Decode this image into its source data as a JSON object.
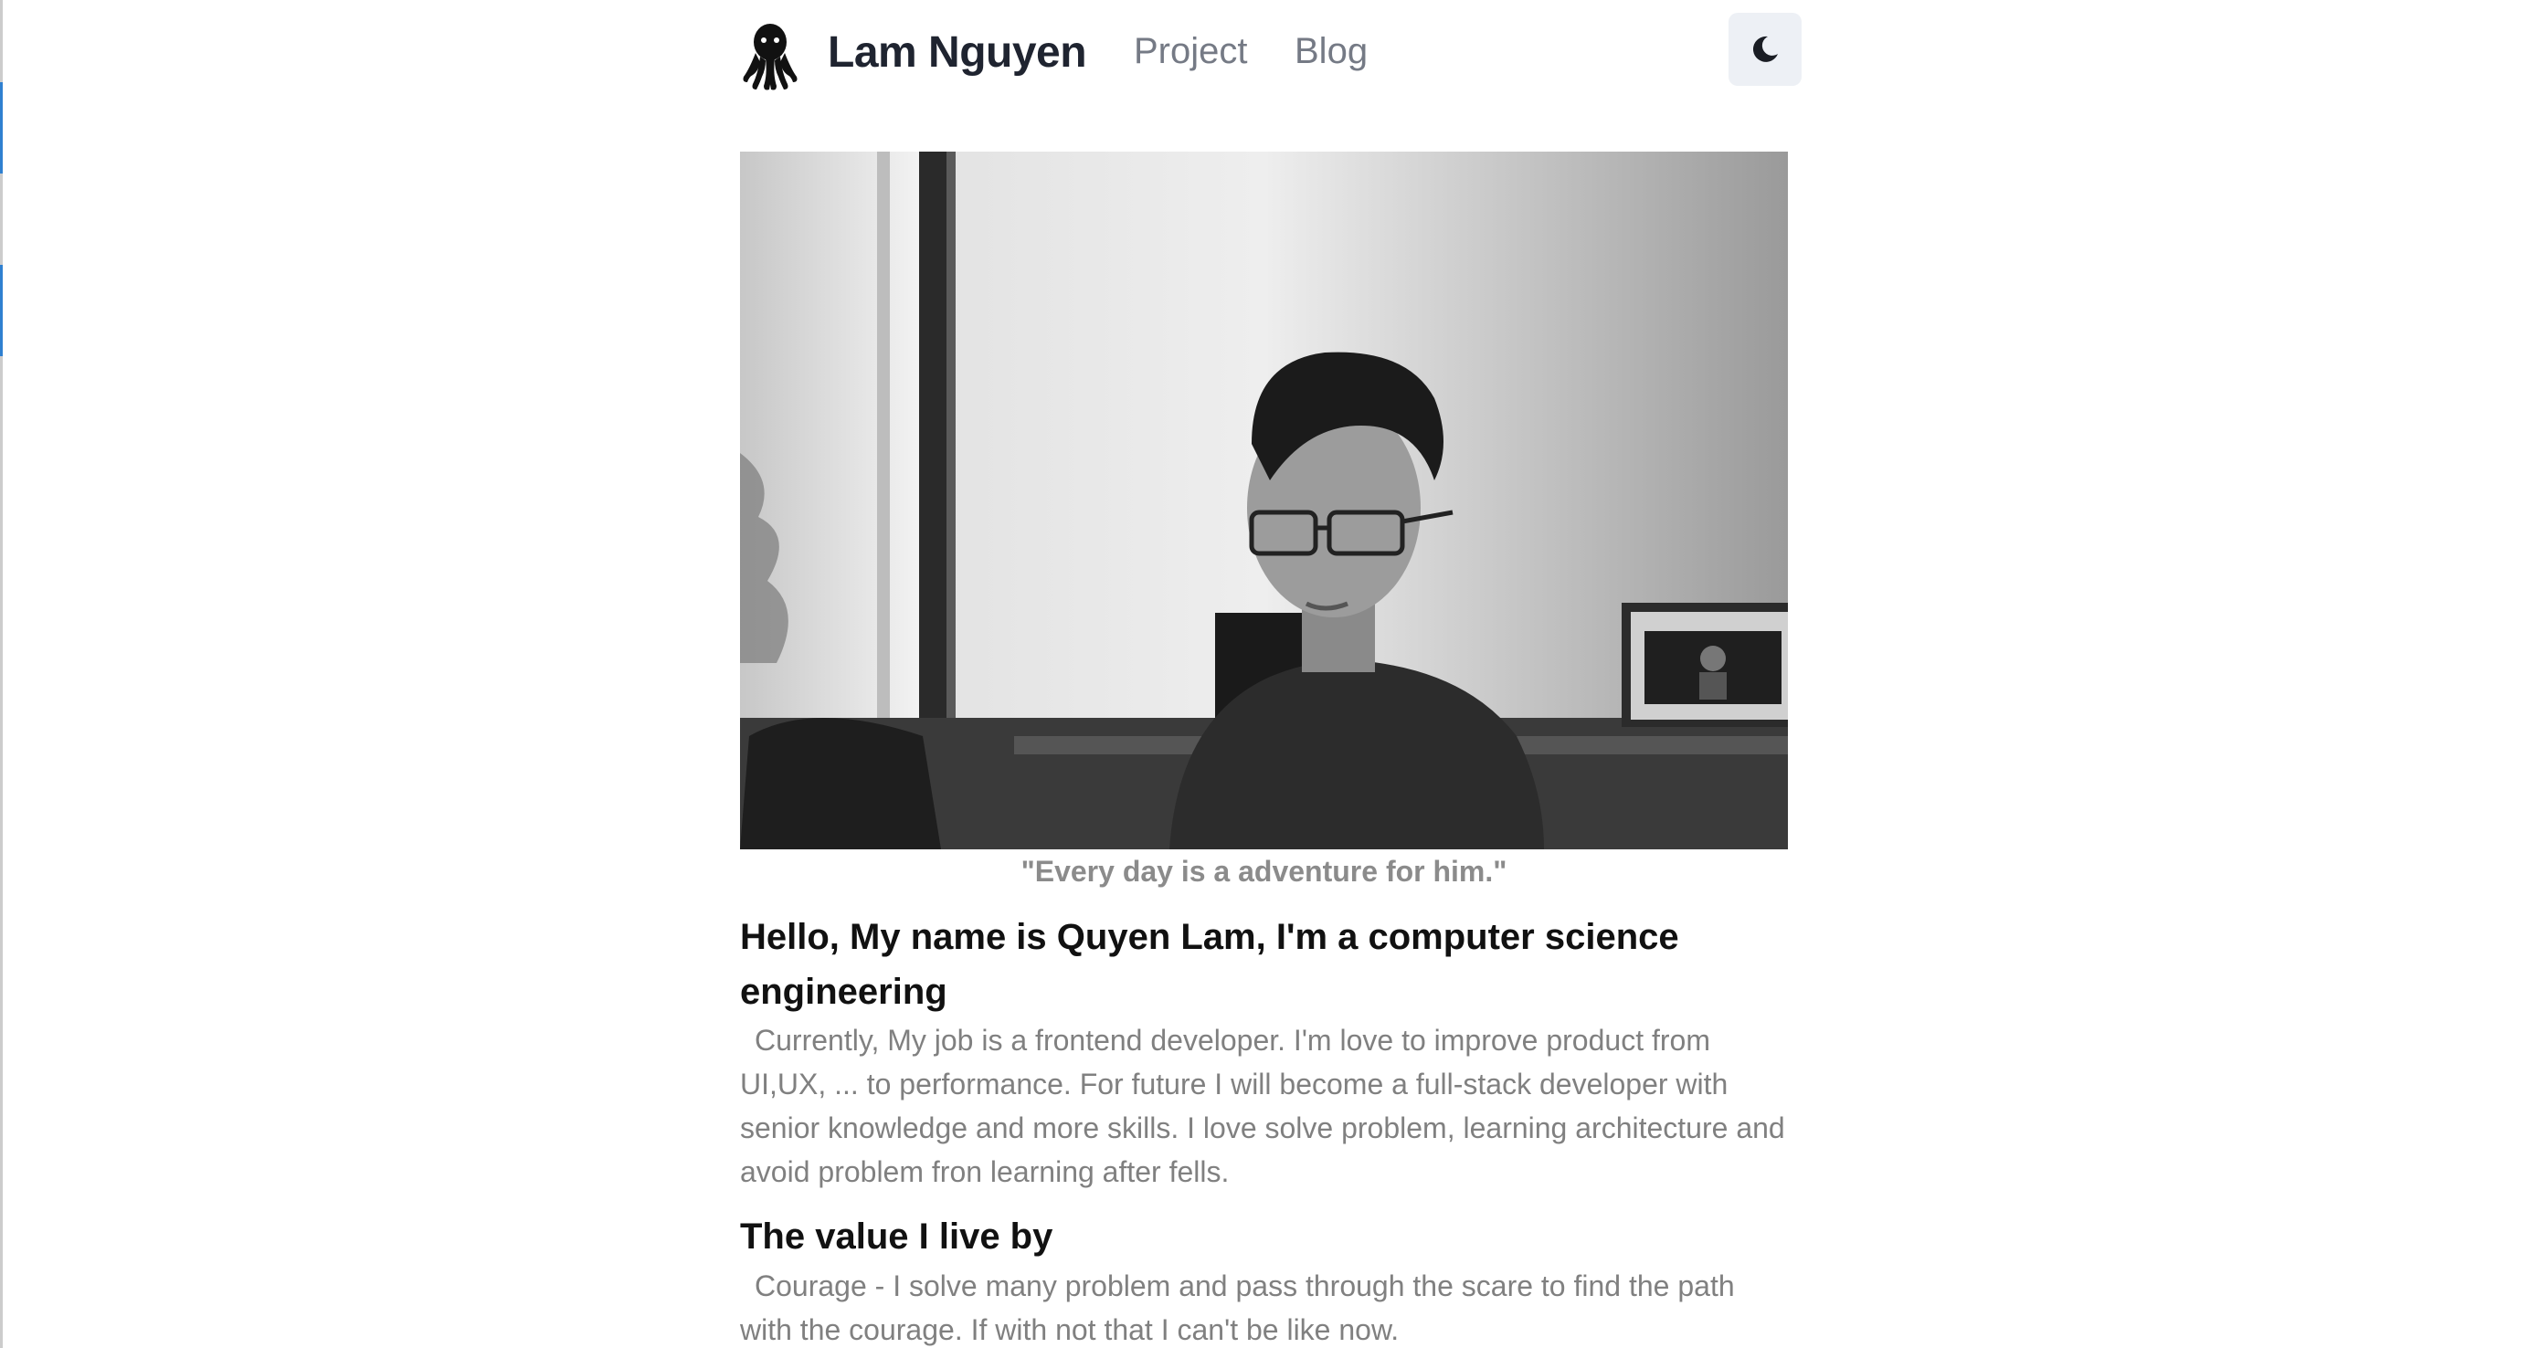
{
  "header": {
    "logo_icon": "octopus-icon",
    "brand": "Lam Nguyen",
    "nav": [
      {
        "label": "Project"
      },
      {
        "label": "Blog"
      }
    ],
    "theme_toggle_icon": "moon-icon"
  },
  "hero": {
    "photo_icon": "portrait-photo",
    "caption": "\"Every day is a adventure for him.\""
  },
  "about": {
    "heading": "Hello, My name is Quyen Lam, I'm a computer science engineering",
    "text": "Currently, My job is a frontend developer. I'm love to improve product from UI,UX, ... to performance. For future I will become a full-stack developer with senior knowledge and more skills. I love solve problem, learning architecture and avoid problem fron learning after fells."
  },
  "values": {
    "heading": "The value I live by",
    "text": "Courage - I solve many problem and pass through the scare to find the path with the courage. If with not that I can't be like now."
  },
  "colors": {
    "toggle_bg": "#edf0f5",
    "nav_text": "#757a85",
    "body_text": "#808080"
  }
}
